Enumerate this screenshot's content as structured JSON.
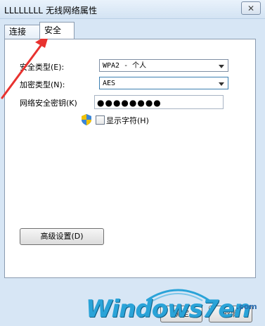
{
  "window": {
    "title": "LLLLLLLL 无线网络属性",
    "close_symbol": "✕"
  },
  "tabs": [
    {
      "label": "连接",
      "selected": false
    },
    {
      "label": "安全",
      "selected": true
    }
  ],
  "security": {
    "security_type": {
      "label": "安全类型(E):",
      "value": "WPA2 - 个人"
    },
    "encryption_type": {
      "label": "加密类型(N):",
      "value": "AES"
    },
    "network_key": {
      "label": "网络安全密钥(K)",
      "masked_value": "●●●●●●●●"
    },
    "show_characters": {
      "label": "显示字符(H)",
      "checked": false
    }
  },
  "buttons": {
    "advanced": "高级设置(D)",
    "ok": "确定",
    "cancel": "取消"
  },
  "annotation": {
    "color": "#e8322f"
  },
  "watermark": {
    "text": "Windows7en",
    "suffix": ".com"
  },
  "colors": {
    "window_bg": "#d7e6f5",
    "panel_bg": "#ffffff",
    "focus_border": "#3c7fb1",
    "watermark_blue": "#2aa3d8"
  }
}
